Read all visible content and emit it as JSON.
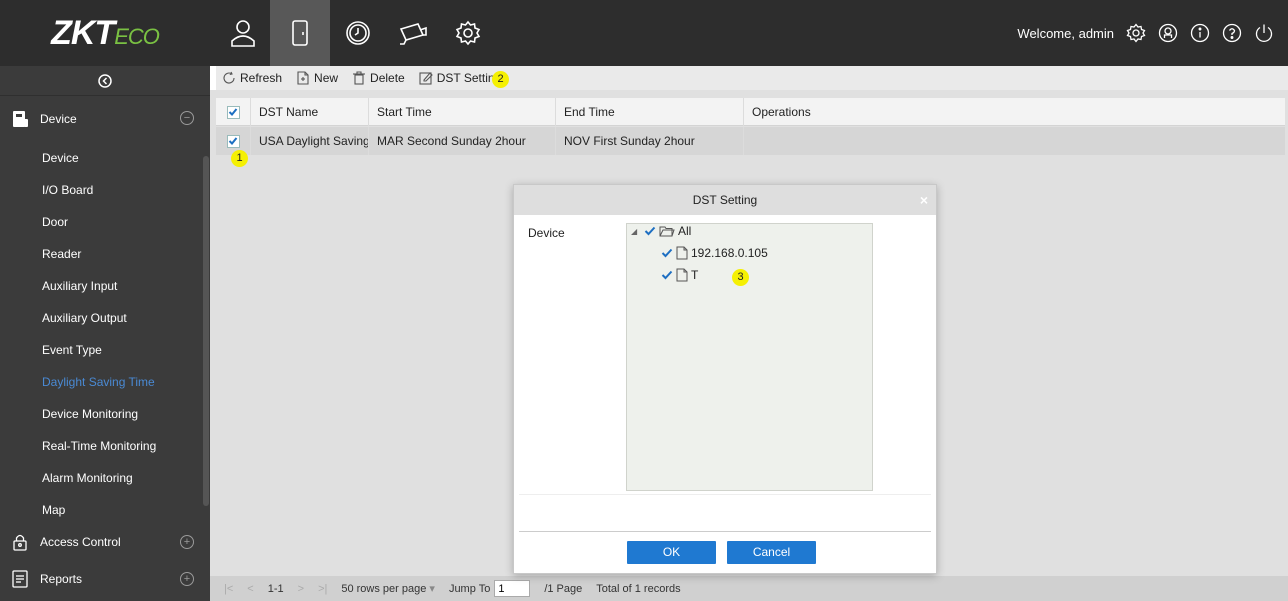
{
  "brand": {
    "logo_main": "ZKT",
    "logo_sub": "ECO"
  },
  "topnav": {
    "items": [
      "person-icon",
      "door-icon",
      "clock-icon",
      "camera-icon",
      "settings-icon"
    ],
    "active": "door-icon"
  },
  "topright": {
    "welcome": "Welcome, admin",
    "icons": [
      "gear-icon",
      "user-circle-icon",
      "info-icon",
      "help-icon",
      "power-icon"
    ]
  },
  "sidebar": {
    "groups": [
      {
        "label": "Device",
        "toggle": "⊖"
      },
      {
        "label": "Access Control",
        "toggle": "⊕"
      },
      {
        "label": "Reports",
        "toggle": "⊕"
      }
    ],
    "items": [
      {
        "label": "Device"
      },
      {
        "label": "I/O Board"
      },
      {
        "label": "Door"
      },
      {
        "label": "Reader"
      },
      {
        "label": "Auxiliary Input"
      },
      {
        "label": "Auxiliary Output"
      },
      {
        "label": "Event Type"
      },
      {
        "label": "Daylight Saving Time"
      },
      {
        "label": "Device Monitoring"
      },
      {
        "label": "Real-Time Monitoring"
      },
      {
        "label": "Alarm Monitoring"
      },
      {
        "label": "Map"
      }
    ],
    "active_item": "Daylight Saving Time",
    "active_color": "#4a8ad4"
  },
  "toolbar": {
    "refresh": "Refresh",
    "new": "New",
    "delete": "Delete",
    "dst_setting": "DST Setting"
  },
  "grid": {
    "headers": [
      "DST Name",
      "Start Time",
      "End Time",
      "Operations"
    ],
    "rows": [
      {
        "checked": true,
        "name": "USA Daylight Saving Tin",
        "start": "MAR Second Sunday 2hour",
        "end": "NOV First Sunday 2hour",
        "ops": ""
      }
    ]
  },
  "footer": {
    "range": "1-1",
    "rows_per_page": "50 rows per page",
    "jump_label": "Jump To",
    "jump_value": "1",
    "pages": "/1 Page",
    "total": "Total of 1 records"
  },
  "badges": [
    "1",
    "2",
    "3"
  ],
  "modal": {
    "title": "DST Setting",
    "close": "×",
    "device_label": "Device",
    "tree": {
      "root": "All",
      "children": [
        "192.168.0.105",
        "T"
      ]
    },
    "ok": "OK",
    "cancel": "Cancel"
  },
  "colors": {
    "accent": "#1f79d1",
    "badge": "#f5f003",
    "topbar": "#2d2d2d",
    "sidebar": "#3b3b3b"
  }
}
